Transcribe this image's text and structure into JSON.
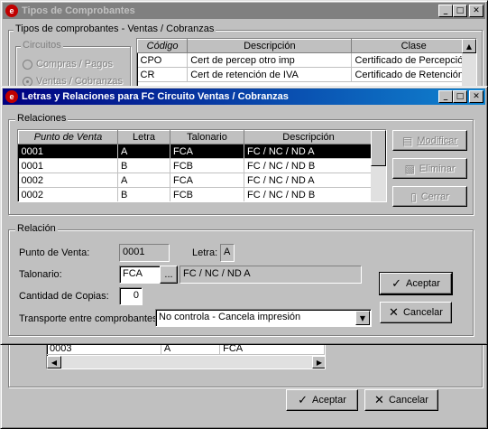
{
  "back_window": {
    "title": "Tipos de Comprobantes",
    "group_label": "Tipos de comprobantes - Ventas / Cobranzas",
    "circuitos_label": "Circuitos",
    "radio_compras": "Compras / Pagos",
    "radio_ventas": "Ventas / Cobranzas",
    "table": {
      "headers": [
        "Código",
        "Descripción",
        "Clase"
      ],
      "rows": [
        [
          "CPO",
          "Cert de percep otro imp",
          "Certificado de Percepción"
        ],
        [
          "CR",
          "Cert de retención de IVA",
          "Certificado de Retención"
        ]
      ]
    },
    "lower_row": [
      "0003",
      "A",
      "FCA"
    ],
    "aceptar_label": "Aceptar",
    "cancelar_label": "Cancelar"
  },
  "dialog": {
    "title": "Letras y Relaciones para FC Circuito Ventas / Cobranzas",
    "relaciones_label": "Relaciones",
    "table": {
      "headers": [
        "Punto de Venta",
        "Letra",
        "Talonario",
        "Descripción"
      ],
      "rows": [
        [
          "0001",
          "A",
          "FCA",
          "FC / NC  / ND A"
        ],
        [
          "0001",
          "B",
          "FCB",
          "FC / NC  / ND B"
        ],
        [
          "0002",
          "A",
          "FCA",
          "FC / NC  / ND A"
        ],
        [
          "0002",
          "B",
          "FCB",
          "FC / NC  / ND B"
        ]
      ]
    },
    "btn_modificar": "Modificar",
    "btn_eliminar": "Eliminar",
    "btn_cerrar": "Cerrar",
    "relacion_label": "Relación",
    "punto_venta_label": "Punto de Venta:",
    "punto_venta_value": "0001",
    "letra_label": "Letra:",
    "letra_value": "A",
    "talonario_label": "Talonario:",
    "talonario_value": "FCA",
    "talonario_desc": "FC / NC  / ND A",
    "browse_label": "...",
    "copias_label": "Cantidad de Copias:",
    "copias_value": "0",
    "transporte_label": "Transporte entre comprobantes:",
    "transporte_value": "No controla - Cancela impresión",
    "aceptar_label": "Aceptar",
    "cancelar_label": "Cancelar"
  }
}
